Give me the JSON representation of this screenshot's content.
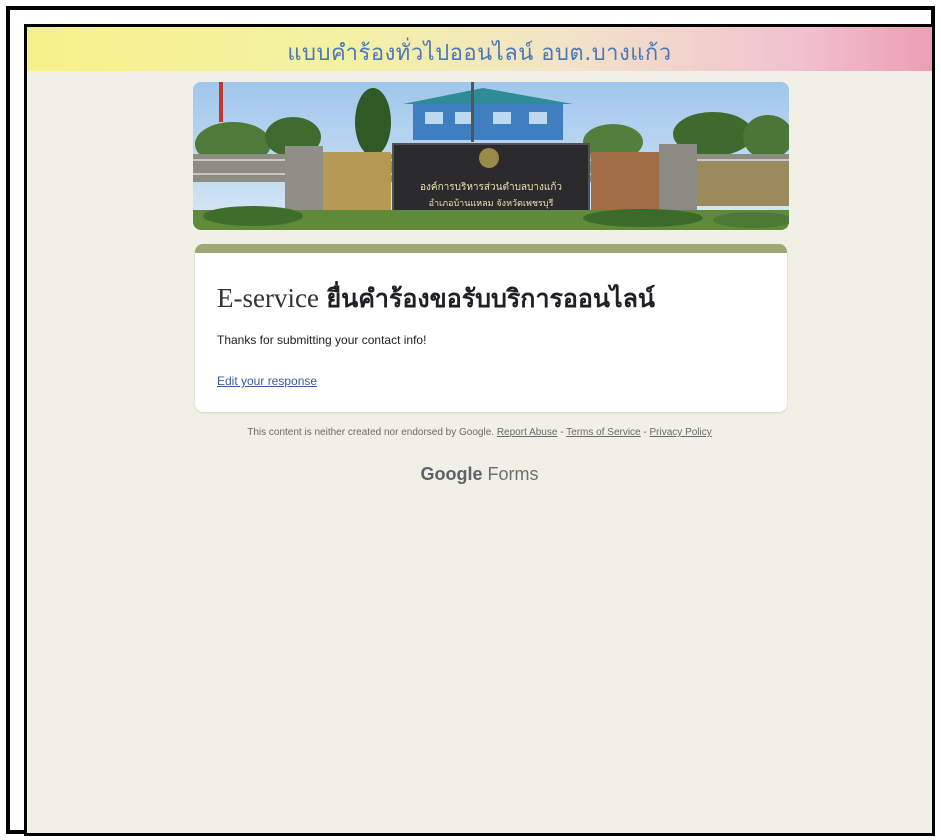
{
  "banner": {
    "title": "แบบคำร้องทั่วไปออนไลน์ อบต.บางแก้ว"
  },
  "header_image": {
    "sign_line1": "องค์การบริหารส่วนตำบลบางแก้ว",
    "sign_line2": "อำเภอบ้านแหลม จังหวัดเพชรบุรี"
  },
  "form": {
    "title_latin": "E-service",
    "title_thai": "ยื่นคำร้องขอรับบริการออนไลน์",
    "message": "Thanks for submitting your contact info!",
    "edit_link": "Edit your response",
    "accent_color": "#9ea873"
  },
  "footer": {
    "disclaimer": "This content is neither created nor endorsed by Google.",
    "report_abuse": "Report Abuse",
    "sep1": " - ",
    "terms": "Terms of Service",
    "sep2": " - ",
    "privacy": "Privacy Policy"
  },
  "brand": {
    "google": "Google",
    "forms": "Forms"
  },
  "colors": {
    "page_background": "#f0f0e6",
    "banner_left": "#f6f08a",
    "banner_right": "#ec9eb4",
    "banner_text": "#4a78b8"
  }
}
